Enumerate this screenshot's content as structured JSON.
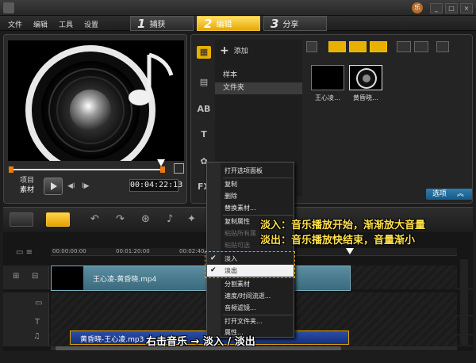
{
  "menu": {
    "file": "文件",
    "edit": "编辑",
    "tools": "工具",
    "settings": "设置"
  },
  "steps": [
    {
      "num": "1",
      "label": "捕获"
    },
    {
      "num": "2",
      "label": "编辑"
    },
    {
      "num": "3",
      "label": "分享"
    }
  ],
  "window": {
    "user_badge": "乐",
    "minimize": "_",
    "maximize": "□",
    "close": "×"
  },
  "preview": {
    "mode_project": "项目",
    "mode_clip": "素材",
    "prev_symbol": "◀I",
    "next_symbol": "I▶",
    "timecode": "00:04:22:13",
    "image_icon": "music-note-speaker-image"
  },
  "library": {
    "add_label": "添加",
    "folders": [
      "样本",
      "文件夹"
    ],
    "side_labels": {
      "title": "AB",
      "text": "T",
      "fx": "FX"
    },
    "collapse_symbol": "«",
    "items": [
      {
        "label": "王心凌…",
        "icon": "video-clip-thumbnail"
      },
      {
        "label": "黄昏晓…",
        "icon": "audio-speaker-thumbnail"
      }
    ],
    "options_label": "选项"
  },
  "timeline": {
    "ticks": [
      "00:00:00:00",
      "00:01:20:00",
      "00:02:40:00"
    ],
    "video_clip_label": "王心凌-黄昏晓.mp4",
    "audio_clip_label": "黄昏晓-王心凌.mp3"
  },
  "context_menu": {
    "open_options_panel": "打开选项面板",
    "copy": "复制",
    "delete": "删除",
    "replace_clip": "替换素材...",
    "copy_attributes": "复制属性",
    "paste_all_attributes": "粘贴所有属",
    "paste_selectable": "粘贴可选",
    "fade_in": "淡入",
    "fade_out": "淡出",
    "split_clip": "分割素材",
    "speed_time_stretch": "速度/时间流逝...",
    "audio_filter": "音频滤镜...",
    "open_file_folder": "打开文件夹...",
    "properties": "属性...",
    "check_symbol": "✔"
  },
  "annotations": {
    "fade_in_desc": "淡入：音乐播放开始，渐渐放大音量",
    "fade_out_desc": "淡出：音乐播放快结束，音量渐小",
    "bottom_note": "右击音乐 → 淡入 / 淡出"
  },
  "colors": {
    "accent": "#e8b000",
    "annotation": "#ffe14a",
    "options_blue": "#1f6e9e",
    "video_clip": "#4a7e90",
    "audio_clip": "#1f3f95"
  }
}
